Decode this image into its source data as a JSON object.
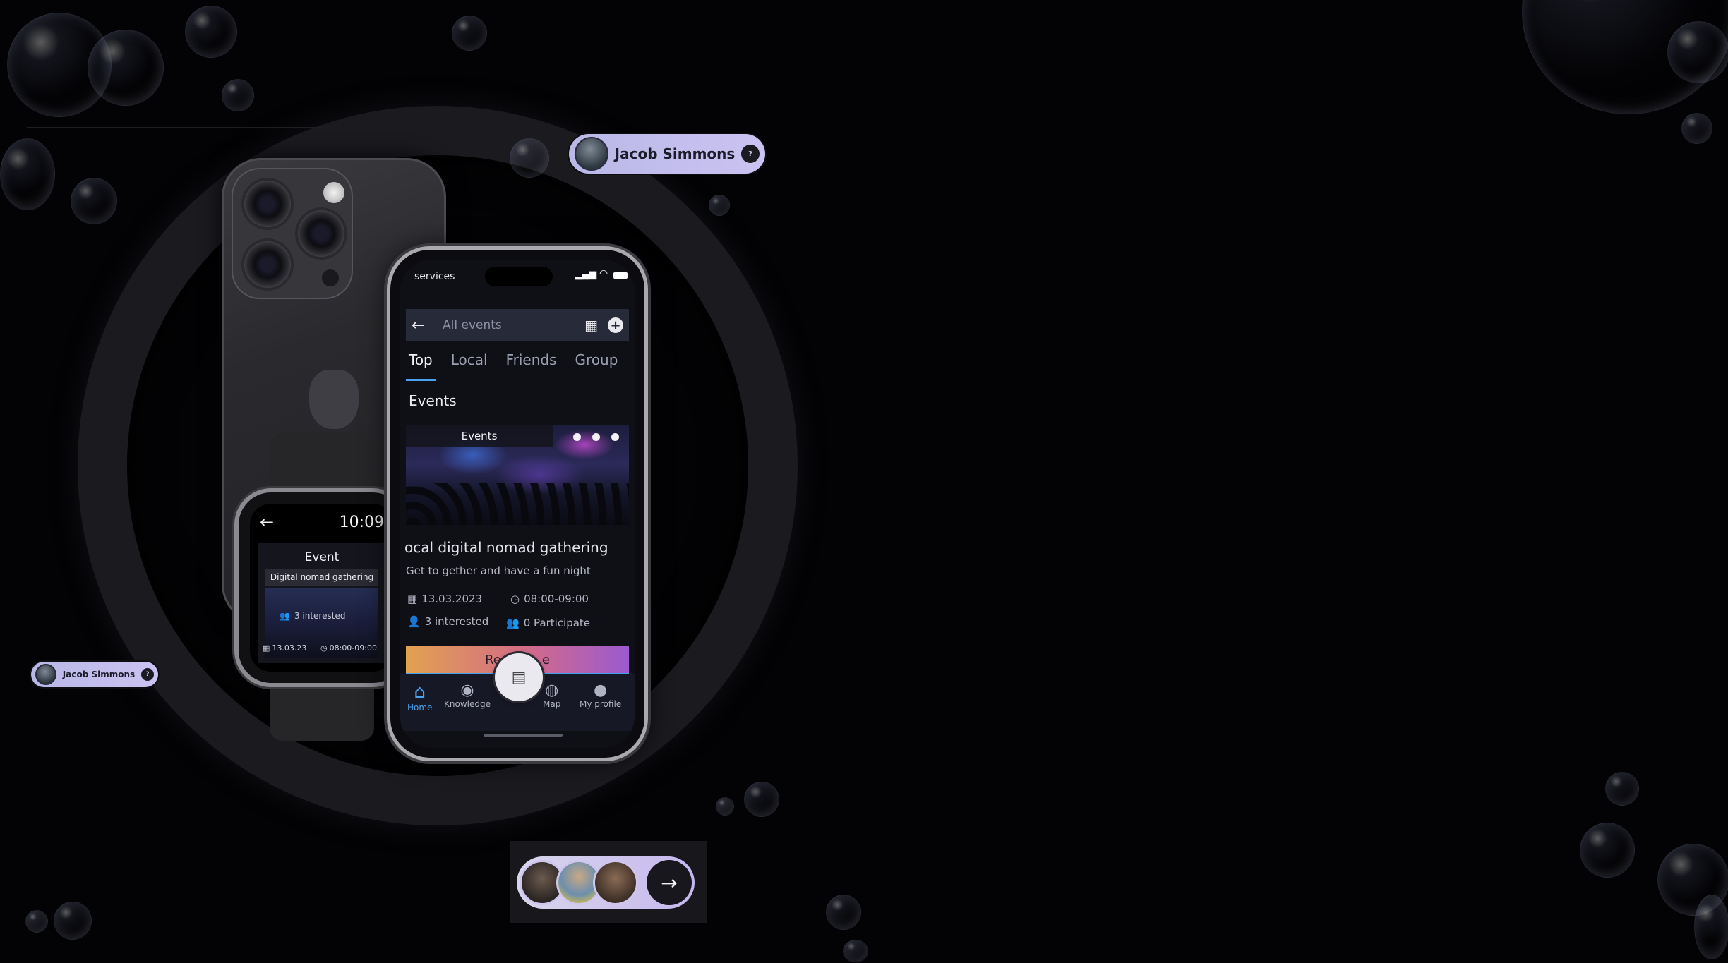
{
  "theme": {
    "accent": "#4aa3f0",
    "chip": "#c4c2ee",
    "background": "#030305"
  },
  "chips": {
    "top": {
      "name": "Jacob Simmons"
    },
    "left": {
      "name": "Jacob Simmons"
    }
  },
  "phone": {
    "status_label": "services",
    "search_placeholder": "All events",
    "tabs": [
      "Top",
      "Local",
      "Friends",
      "Group"
    ],
    "section_title": "Events",
    "card": {
      "image_label": "Events",
      "title": "ocal digital nomad gathering",
      "subtitle": "Get to gether and have a fun night",
      "date": "13.03.2023",
      "time": "08:00-09:00",
      "interested": "3 interested",
      "participate": "0 Participate",
      "reserve_button": "Re",
      "reserve_button_tail": "e"
    },
    "nav": [
      {
        "label": "Home",
        "icon": "home-icon"
      },
      {
        "label": "Knowledge",
        "icon": "owl-icon"
      },
      {
        "label": "Map",
        "icon": "globe-icon"
      },
      {
        "label": "My profile",
        "icon": "profile-icon"
      }
    ]
  },
  "watch": {
    "time": "10:09",
    "title": "Event",
    "event_name": "Digital nomad gathering",
    "interested": "3 interested",
    "date": "13.03.23",
    "time_range": "08:00-09:00"
  }
}
